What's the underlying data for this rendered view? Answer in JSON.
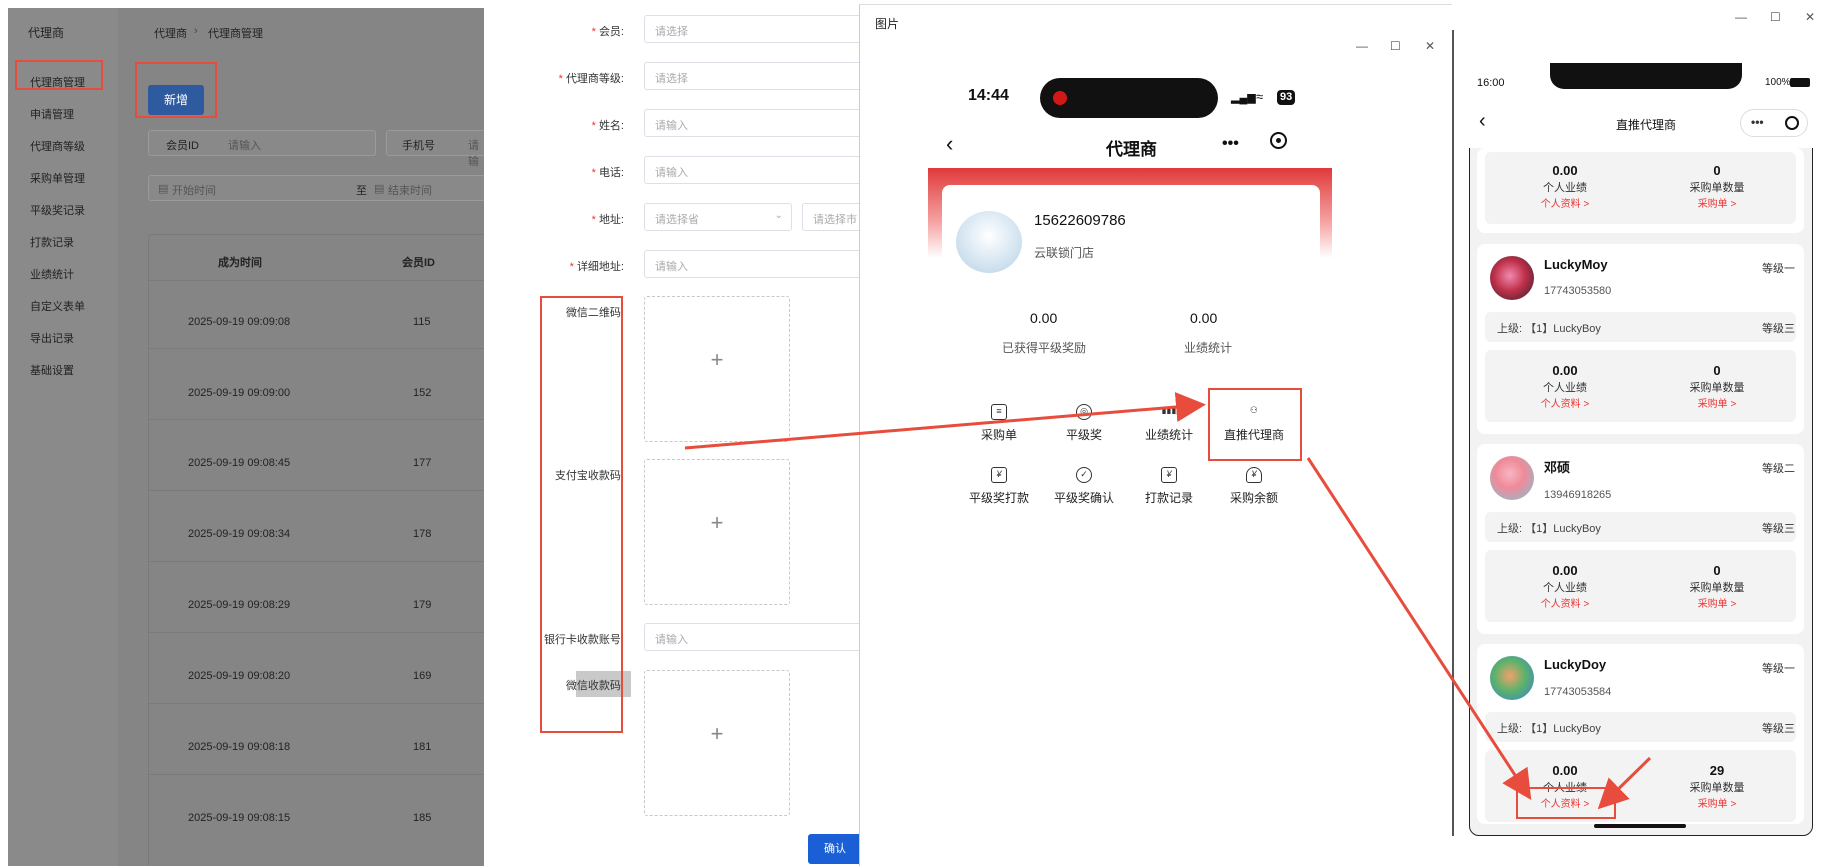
{
  "admin": {
    "brand": "代理商",
    "menu": [
      "代理商管理",
      "申请管理",
      "代理商等级",
      "采购单管理",
      "平级奖记录",
      "打款记录",
      "业绩统计",
      "自定义表单",
      "导出记录",
      "基础设置"
    ],
    "breadcrumb": [
      "代理商",
      "代理商管理"
    ],
    "add_button": "新增",
    "filters": {
      "member_id_label": "会员ID",
      "member_id_placeholder": "请输入",
      "phone_label": "手机号",
      "phone_placeholder": "请输",
      "start_placeholder": "开始时间",
      "to": "至",
      "end_placeholder": "结束时间"
    },
    "table": {
      "columns": [
        "成为时间",
        "会员ID"
      ],
      "rows": [
        [
          "2025-09-19 09:09:08",
          "115"
        ],
        [
          "2025-09-19 09:09:00",
          "152"
        ],
        [
          "2025-09-19 09:08:45",
          "177"
        ],
        [
          "2025-09-19 09:08:34",
          "178"
        ],
        [
          "2025-09-19 09:08:29",
          "179"
        ],
        [
          "2025-09-19 09:08:20",
          "169"
        ],
        [
          "2025-09-19 09:08:18",
          "181"
        ],
        [
          "2025-09-19 09:08:15",
          "185"
        ]
      ]
    }
  },
  "form": {
    "fields": [
      {
        "label": "会员:",
        "required": true,
        "placeholder": "请选择"
      },
      {
        "label": "代理商等级:",
        "required": true,
        "placeholder": "请选择"
      },
      {
        "label": "姓名:",
        "required": true,
        "placeholder": "请输入"
      },
      {
        "label": "电话:",
        "required": true,
        "placeholder": "请输入"
      },
      {
        "label": "地址:",
        "required": true,
        "placeholder": "请选择省",
        "placeholder2": "请选择市"
      },
      {
        "label": "详细地址:",
        "required": true,
        "placeholder": "请输入"
      }
    ],
    "wechat_qr_label": "微信二维码:",
    "alipay_label": "支付宝收款码:",
    "bank_label": "银行卡收款账号:",
    "bank_placeholder": "请输入",
    "wechat_pay_label": "微信收款码:",
    "upload_plus": "+",
    "confirm": "确认"
  },
  "window1": {
    "title": "图片",
    "controls": [
      "—",
      "☐",
      "✕"
    ],
    "phone": {
      "time": "14:44",
      "battery": "93",
      "nav_title": "代理商",
      "phone_number": "15622609786",
      "store": "云联锁门店",
      "stats": [
        {
          "value": "0.00",
          "label": "已获得平级奖励"
        },
        {
          "value": "0.00",
          "label": "业绩统计"
        }
      ],
      "grid": [
        {
          "label": "采购单",
          "icon": "list-icon"
        },
        {
          "label": "平级奖",
          "icon": "medal-icon"
        },
        {
          "label": "业绩统计",
          "icon": "bar-chart-icon"
        },
        {
          "label": "直推代理商",
          "icon": "org-icon"
        },
        {
          "label": "平级奖打款",
          "icon": "payment-icon"
        },
        {
          "label": "平级奖确认",
          "icon": "confirm-icon"
        },
        {
          "label": "打款记录",
          "icon": "record-icon"
        },
        {
          "label": "采购余额",
          "icon": "yen-icon"
        }
      ]
    }
  },
  "window2": {
    "controls": [
      "—",
      "☐",
      "✕"
    ],
    "phone": {
      "time": "16:00",
      "battery": "100%",
      "nav_title": "直推代理商",
      "top_stat": {
        "value1": "0.00",
        "label1": "个人业绩",
        "link1": "个人资料 >",
        "value2": "0",
        "label2": "采购单数量",
        "link2": "采购单 >"
      },
      "agents": [
        {
          "name": "LuckyMoy",
          "phone": "17743053580",
          "level": "等级一",
          "superior": "上级: 【1】LuckyBoy",
          "superior_level": "等级三",
          "value1": "0.00",
          "label1": "个人业绩",
          "link1": "个人资料 >",
          "value2": "0",
          "label2": "采购单数量",
          "link2": "采购单 >"
        },
        {
          "name": "邓硕",
          "phone": "13946918265",
          "level": "等级二",
          "superior": "上级: 【1】LuckyBoy",
          "superior_level": "等级三",
          "value1": "0.00",
          "label1": "个人业绩",
          "link1": "个人资料 >",
          "value2": "0",
          "label2": "采购单数量",
          "link2": "采购单 >"
        },
        {
          "name": "LuckyDoy",
          "phone": "17743053584",
          "level": "等级一",
          "superior": "上级: 【1】LuckyBoy",
          "superior_level": "等级三",
          "value1": "0.00",
          "label1": "个人业绩",
          "link1": "个人资料 >",
          "value2": "29",
          "label2": "采购单数量",
          "link2": "采购单 >"
        }
      ]
    }
  },
  "colors": {
    "annotation": "#e74c3c",
    "primary": "#1a5fd6",
    "accent_red": "#e33"
  }
}
